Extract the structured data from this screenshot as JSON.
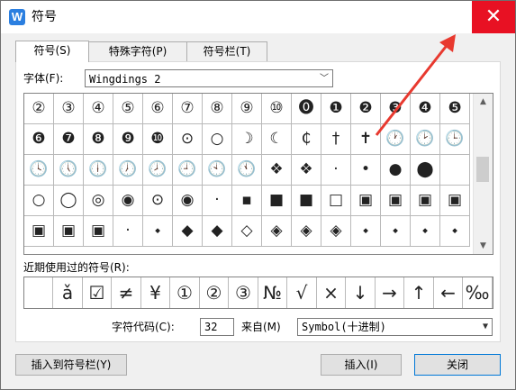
{
  "window": {
    "title": "符号",
    "app_icon": "W",
    "close_glyph": "✕"
  },
  "tabs": [
    "符号(S)",
    "特殊字符(P)",
    "符号栏(T)"
  ],
  "font": {
    "label": "字体(F):",
    "value": "Wingdings 2"
  },
  "symbols": [
    "②",
    "③",
    "④",
    "⑤",
    "⑥",
    "⑦",
    "⑧",
    "⑨",
    "⑩",
    "⓿",
    "❶",
    "❷",
    "❸",
    "❹",
    "❺",
    "❻",
    "❼",
    "❽",
    "❾",
    "❿",
    "⊙",
    "○",
    "☽",
    "☾",
    "₵",
    "†",
    "✝",
    "🕐",
    "🕑",
    "🕒",
    "🕓",
    "🕔",
    "🕕",
    "🕖",
    "🕗",
    "🕘",
    "🕙",
    "🕚",
    "❖",
    "❖",
    "·",
    "•",
    "●",
    "⬤",
    "",
    "○",
    "◯",
    "◎",
    "◉",
    "⊙",
    "◉",
    "·",
    "▪",
    "■",
    "■",
    "□",
    "▣",
    "▣",
    "▣",
    "▣",
    "▣",
    "▣",
    "▣",
    "·",
    "⬩",
    "◆",
    "◆",
    "◇",
    "◈",
    "◈",
    "◈",
    "⬩",
    "⬩",
    "⬩",
    "⬩"
  ],
  "recent": {
    "label": "近期使用过的符号(R):",
    "symbols": [
      "",
      "ǎ",
      "☑",
      "≠",
      "¥",
      "①",
      "②",
      "③",
      "№",
      "√",
      "×",
      "↓",
      "→",
      "↑",
      "←",
      "‰"
    ]
  },
  "charcode": {
    "label": "字符代码(C):",
    "value": "32",
    "from_label": "来自(M)",
    "from_value": "Symbol(十进制)"
  },
  "buttons": {
    "insert_to_bar": "插入到符号栏(Y)",
    "insert": "插入(I)",
    "close": "关闭"
  },
  "colors": {
    "close_bg": "#e81123",
    "arrow": "#e8392f"
  }
}
